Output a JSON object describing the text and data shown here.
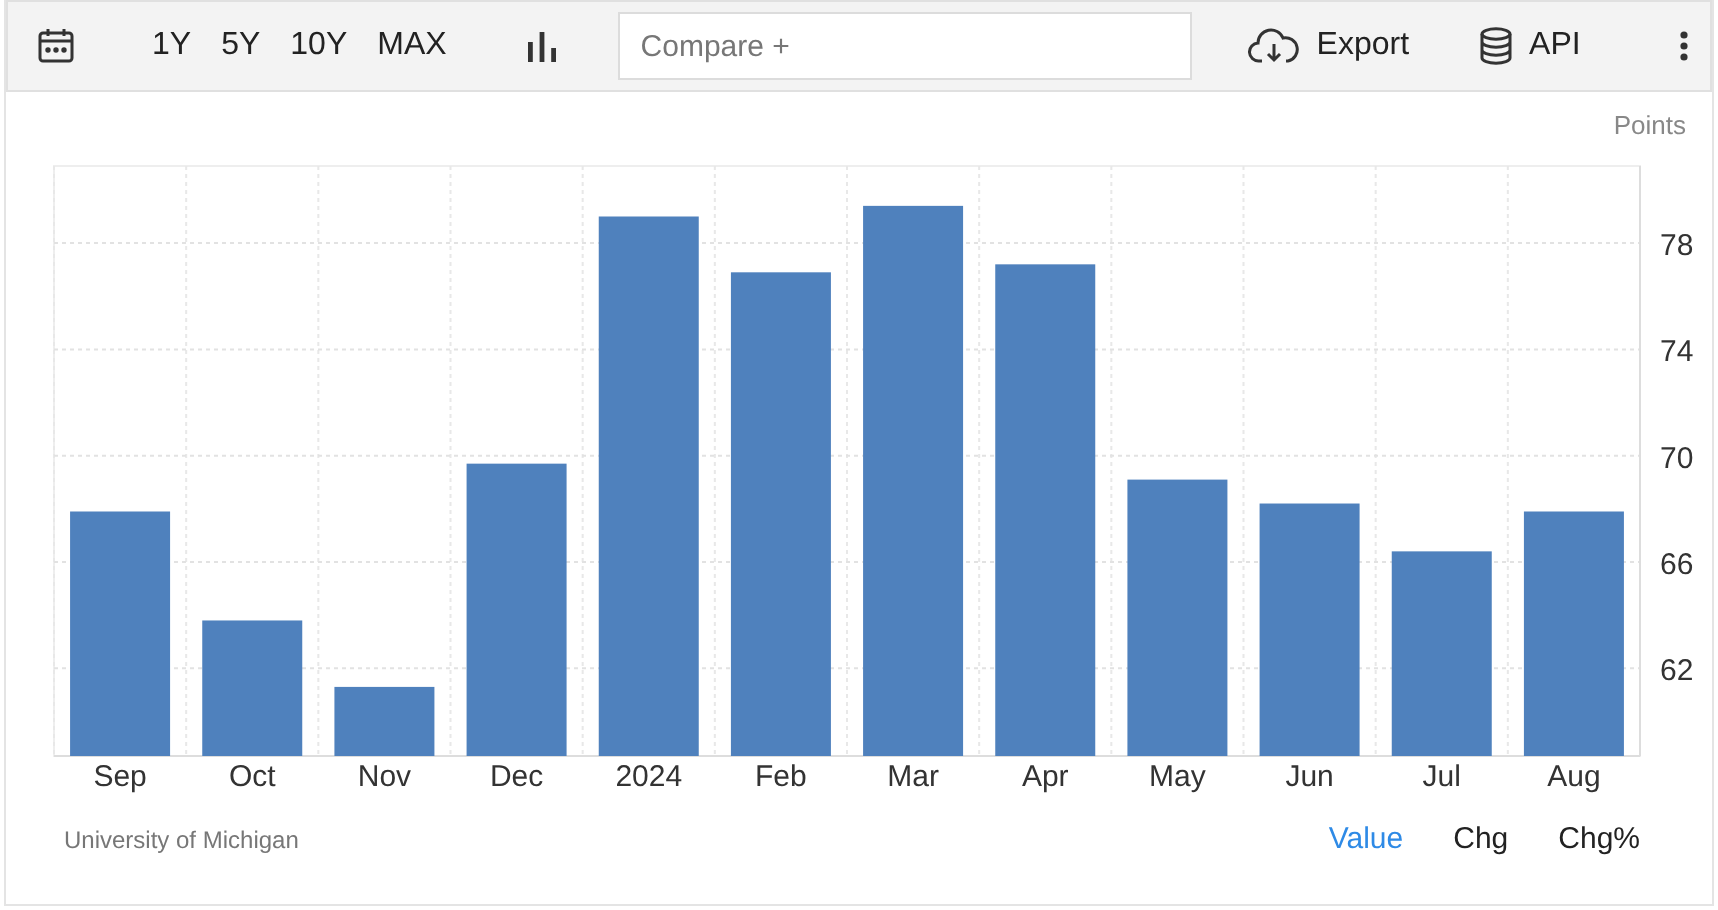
{
  "toolbar": {
    "ranges": [
      "1Y",
      "5Y",
      "10Y",
      "MAX"
    ],
    "compare": {
      "placeholder": "Compare +"
    },
    "export_label": "Export",
    "api_label": "API"
  },
  "chart": {
    "unit": "Points",
    "chart_data": {
      "type": "bar",
      "categories": [
        "Sep",
        "Oct",
        "Nov",
        "Dec",
        "2024",
        "Feb",
        "Mar",
        "Apr",
        "May",
        "Jun",
        "Jul",
        "Aug"
      ],
      "series": [
        {
          "color": "#4f81bd",
          "values": [
            67.9,
            63.8,
            61.3,
            69.7,
            79.0,
            76.9,
            79.4,
            77.2,
            69.1,
            68.2,
            66.4,
            67.9
          ]
        }
      ],
      "ylim": [
        58.7,
        80.9
      ],
      "grid": true,
      "yticks": [
        62,
        66,
        70,
        74,
        78
      ]
    }
  },
  "footer": {
    "source": "University of Michigan",
    "tabs": [
      {
        "label": "Value",
        "selected": true
      },
      {
        "label": "Chg",
        "selected": false
      },
      {
        "label": "Chg%",
        "selected": false
      }
    ]
  }
}
